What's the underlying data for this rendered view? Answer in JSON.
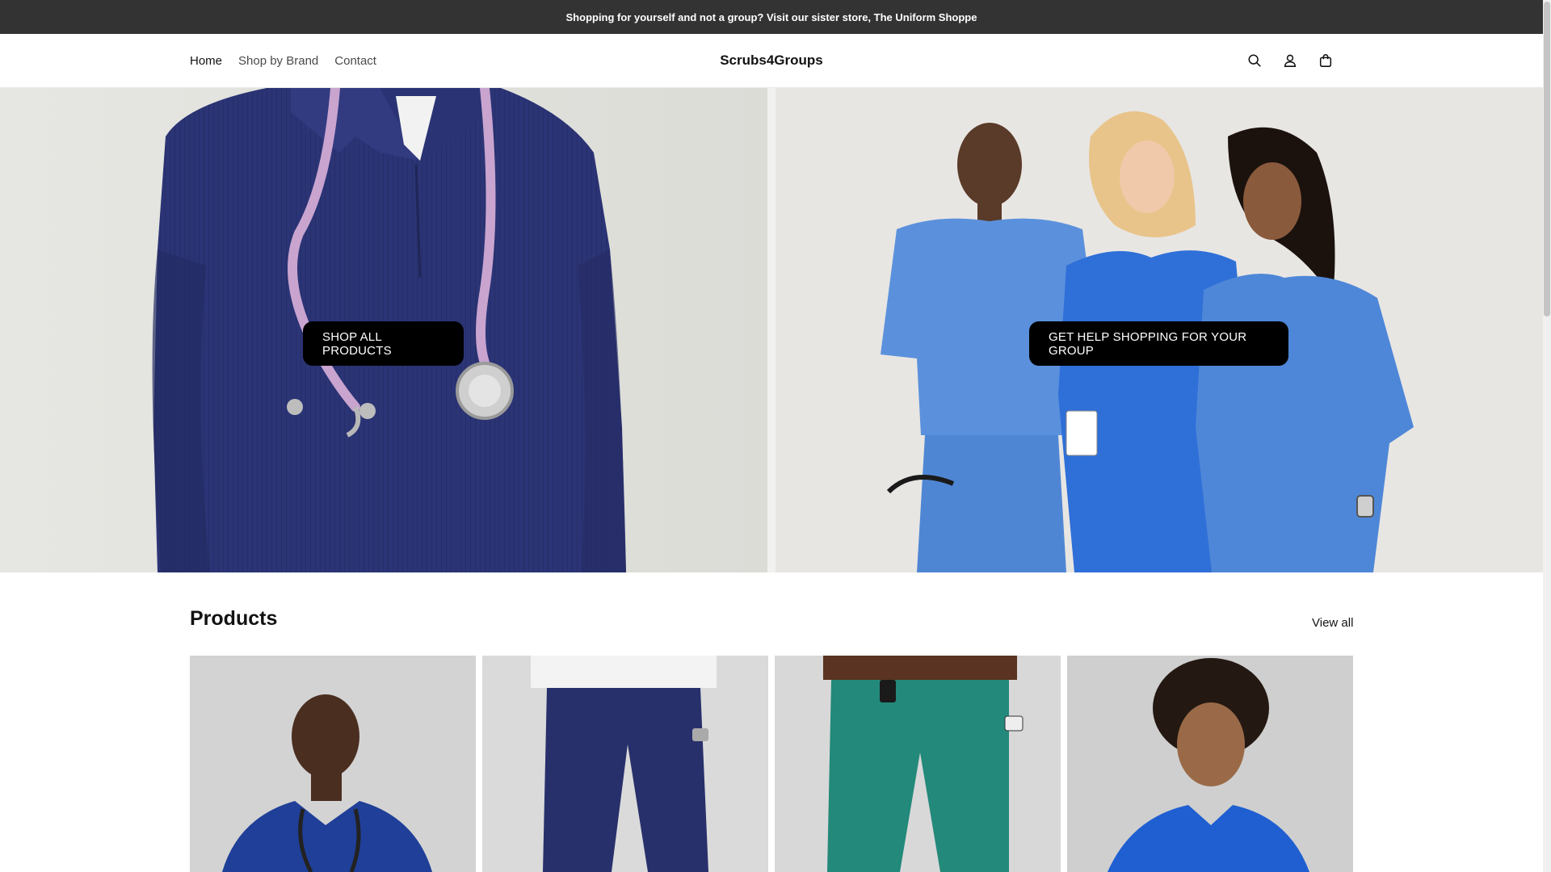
{
  "announcement": {
    "text": "Shopping for yourself and not a group? Visit our sister store, The Uniform Shoppe"
  },
  "header": {
    "nav": [
      {
        "label": "Home"
      },
      {
        "label": "Shop by Brand"
      },
      {
        "label": "Contact"
      }
    ],
    "logo": "Scrubs4Groups",
    "icons": [
      "search-icon",
      "account-icon",
      "cart-icon"
    ]
  },
  "hero": {
    "left_button": "SHOP ALL PRODUCTS",
    "right_button": "GET HELP SHOPPING FOR YOUR GROUP"
  },
  "products": {
    "title": "Products",
    "view_all": "View all"
  },
  "colors": {
    "announcement_bg": "#333333",
    "button_bg": "#000000",
    "navy_scrubs": "#27306b",
    "ceil_blue_scrubs": "#4a84d6",
    "teal_scrubs": "#23897a",
    "royal_blue_scrubs": "#1f5fd1"
  }
}
